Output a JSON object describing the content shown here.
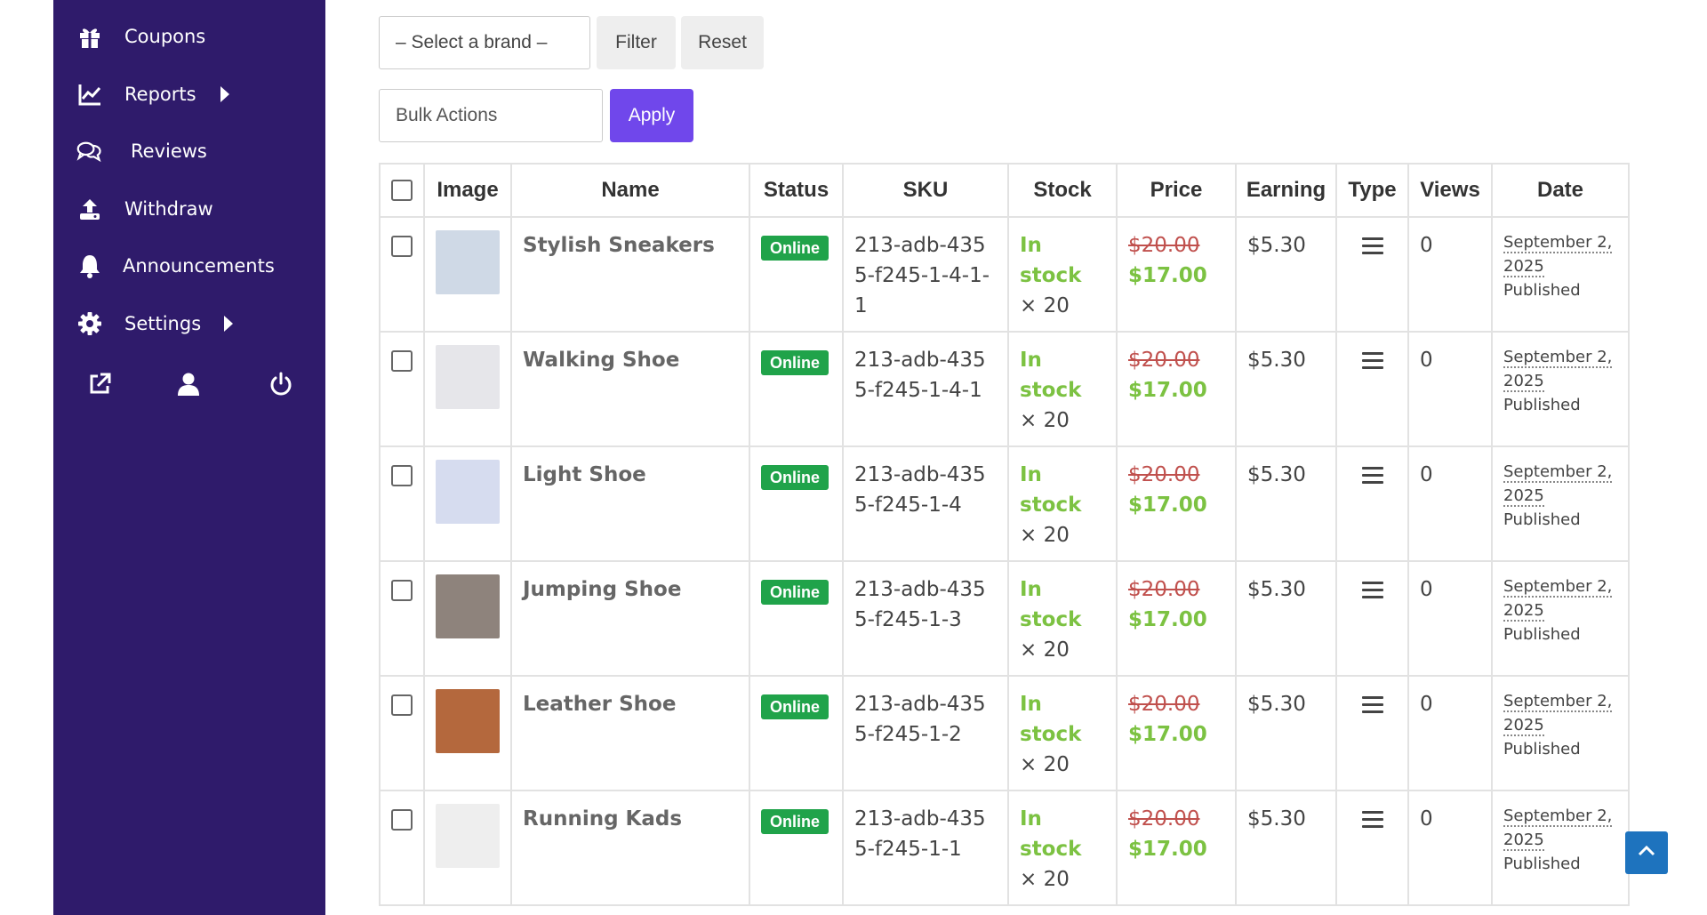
{
  "sidebar": {
    "items": [
      {
        "label": "Coupons",
        "icon": "gift-icon"
      },
      {
        "label": "Reports",
        "icon": "chart-line-icon"
      },
      {
        "label": "Reviews",
        "icon": "comments-icon"
      },
      {
        "label": "Withdraw",
        "icon": "upload-icon"
      },
      {
        "label": "Announcements",
        "icon": "bell-icon"
      },
      {
        "label": "Settings",
        "icon": "gear-icon"
      }
    ],
    "footer": [
      "external-link-icon",
      "user-icon",
      "power-icon"
    ]
  },
  "filters": {
    "brand_placeholder": "– Select a brand –",
    "filter_label": "Filter",
    "reset_label": "Reset",
    "bulk_label": "Bulk Actions",
    "apply_label": "Apply"
  },
  "table": {
    "headers": [
      "Image",
      "Name",
      "Status",
      "SKU",
      "Stock",
      "Price",
      "Earning",
      "Type",
      "Views",
      "Date"
    ],
    "rows": [
      {
        "name": "Stylish Sneakers",
        "status": "Online",
        "sku": "213-adb-4355-f245-1-4-1-1",
        "stock": "In stock",
        "qty": "× 20",
        "old_price": "$20.00",
        "price": "$17.00",
        "earning": "$5.30",
        "views": "0",
        "date": "September 2, 2025",
        "state": "Published",
        "thumb_color": "#cfd9e6"
      },
      {
        "name": "Walking Shoe",
        "status": "Online",
        "sku": "213-adb-4355-f245-1-4-1",
        "stock": "In stock",
        "qty": "× 20",
        "old_price": "$20.00",
        "price": "$17.00",
        "earning": "$5.30",
        "views": "0",
        "date": "September 2, 2025",
        "state": "Published",
        "thumb_color": "#e6e6ea"
      },
      {
        "name": "Light Shoe",
        "status": "Online",
        "sku": "213-adb-4355-f245-1-4",
        "stock": "In stock",
        "qty": "× 20",
        "old_price": "$20.00",
        "price": "$17.00",
        "earning": "$5.30",
        "views": "0",
        "date": "September 2, 2025",
        "state": "Published",
        "thumb_color": "#d6dcef"
      },
      {
        "name": "Jumping Shoe",
        "status": "Online",
        "sku": "213-adb-4355-f245-1-3",
        "stock": "In stock",
        "qty": "× 20",
        "old_price": "$20.00",
        "price": "$17.00",
        "earning": "$5.30",
        "views": "0",
        "date": "September 2, 2025",
        "state": "Published",
        "thumb_color": "#8e837c"
      },
      {
        "name": "Leather Shoe",
        "status": "Online",
        "sku": "213-adb-4355-f245-1-2",
        "stock": "In stock",
        "qty": "× 20",
        "old_price": "$20.00",
        "price": "$17.00",
        "earning": "$5.30",
        "views": "0",
        "date": "September 2, 2025",
        "state": "Published",
        "thumb_color": "#b4683d"
      },
      {
        "name": "Running Kads",
        "status": "Online",
        "sku": "213-adb-4355-f245-1-1",
        "stock": "In stock",
        "qty": "× 20",
        "old_price": "$20.00",
        "price": "$17.00",
        "earning": "$5.30",
        "views": "0",
        "date": "September 2, 2025",
        "state": "Published",
        "thumb_color": "#eeeeee"
      }
    ]
  },
  "colors": {
    "sidebar_bg": "#2f1b6b",
    "accent": "#7047eb",
    "online_badge": "#20a34a",
    "in_stock": "#7cc242",
    "old_price": "#c0504d",
    "scroll_top": "#1e73be"
  },
  "scroll_top_icon": "chevron-up-icon"
}
